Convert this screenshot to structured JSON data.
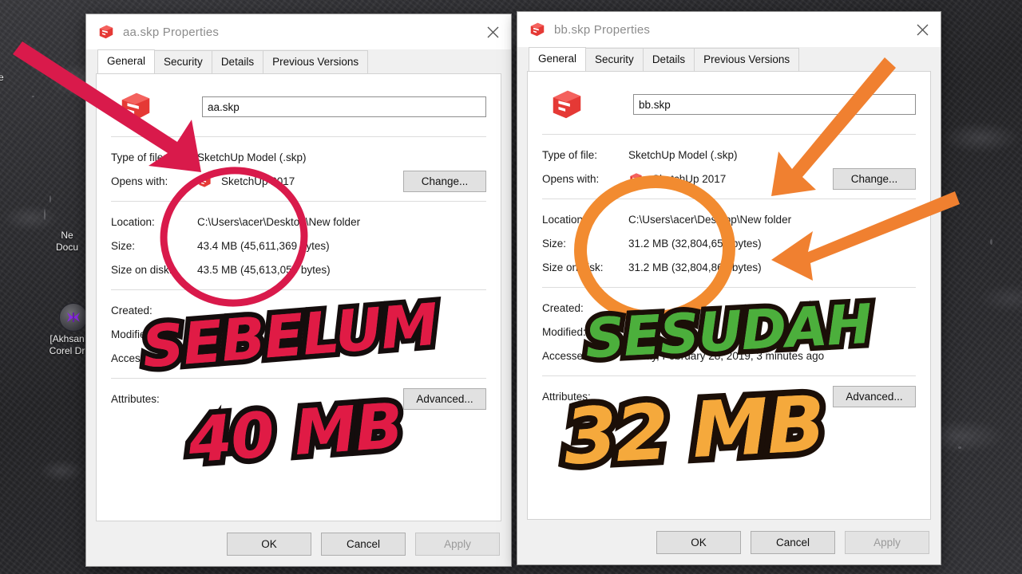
{
  "desktop": {
    "icons": [
      {
        "label": "ke",
        "name": "desktop-icon-partial-top"
      },
      {
        "label": "Ne\nDocu",
        "name": "desktop-icon-new-document"
      },
      {
        "label": "[Akhsan\nCorel Dr",
        "name": "desktop-icon-corel-draw"
      }
    ]
  },
  "dialogs": [
    {
      "id": "left",
      "title": "aa.skp Properties",
      "title_icon": "sketchup-icon",
      "close_label": "✕",
      "tabs": [
        {
          "label": "General",
          "active": true
        },
        {
          "label": "Security",
          "active": false
        },
        {
          "label": "Details",
          "active": false
        },
        {
          "label": "Previous Versions",
          "active": false
        }
      ],
      "filename": "aa.skp",
      "fields": [
        {
          "label": "Type of file:",
          "value": "SketchUp Model (.skp)"
        },
        {
          "label": "Opens with:",
          "value": "SketchUp 2017",
          "icon": "sketchup-icon",
          "button": "Change..."
        },
        {
          "label": "Location:",
          "value": "C:\\Users\\acer\\Desktop\\New folder"
        },
        {
          "label": "Size:",
          "value": "43.4 MB (45,611,369 bytes)"
        },
        {
          "label": "Size on disk:",
          "value": "43.5 MB (45,613,056 bytes)"
        },
        {
          "label": "Created:",
          "value": ""
        },
        {
          "label": "Modified:",
          "value": ""
        },
        {
          "label": "Accessed:",
          "value": ""
        },
        {
          "label": "Attributes:",
          "value": "",
          "button": "Advanced..."
        }
      ],
      "footer": [
        {
          "label": "OK",
          "disabled": false
        },
        {
          "label": "Cancel",
          "disabled": false
        },
        {
          "label": "Apply",
          "disabled": true
        }
      ]
    },
    {
      "id": "right",
      "title": "bb.skp Properties",
      "title_icon": "sketchup-icon",
      "close_label": "✕",
      "tabs": [
        {
          "label": "General",
          "active": true
        },
        {
          "label": "Security",
          "active": false
        },
        {
          "label": "Details",
          "active": false
        },
        {
          "label": "Previous Versions",
          "active": false
        }
      ],
      "filename": "bb.skp",
      "fields": [
        {
          "label": "Type of file:",
          "value": "SketchUp Model (.skp)"
        },
        {
          "label": "Opens with:",
          "value": "SketchUp 2017",
          "icon": "sketchup-icon",
          "button": "Change..."
        },
        {
          "label": "Location:",
          "value": "C:\\Users\\acer\\Desktop\\New folder"
        },
        {
          "label": "Size:",
          "value": "31.2 MB (32,804,659 bytes)"
        },
        {
          "label": "Size on disk:",
          "value": "31.2 MB (32,804,864 bytes)"
        },
        {
          "label": "Created:",
          "value": ""
        },
        {
          "label": "Modified:",
          "value": ""
        },
        {
          "label": "Accessed:",
          "value": "Today, February 28, 2019, 3 minutes ago"
        },
        {
          "label": "Attributes:",
          "value": "",
          "button": "Advanced..."
        }
      ],
      "footer": [
        {
          "label": "OK",
          "disabled": false
        },
        {
          "label": "Cancel",
          "disabled": false
        },
        {
          "label": "Apply",
          "disabled": true
        }
      ]
    }
  ],
  "annotations": {
    "sebelum_text": "SEBELUM",
    "sebelum_size_text": "40 MB",
    "sesudah_text": "SESUDAH",
    "sesudah_size_text": "32 MB",
    "colors": {
      "sebelum_red": "#E01B45",
      "sesudah_green": "#4CAF3C",
      "size_orange": "#F5A93C",
      "arrow_red": "#D91A4B",
      "circle_red": "#D91A4B",
      "arrow_orange": "#F08030",
      "circle_orange": "#F28B30",
      "outline_black": "#140D0D"
    },
    "shapes": [
      {
        "name": "red-arrow-pointing-to-type-of-file"
      },
      {
        "name": "red-ellipse-highlight-size"
      },
      {
        "name": "orange-arrow-pointing-to-opens-with"
      },
      {
        "name": "orange-arrow-pointing-to-size"
      },
      {
        "name": "orange-ellipse-highlight-size"
      }
    ]
  }
}
